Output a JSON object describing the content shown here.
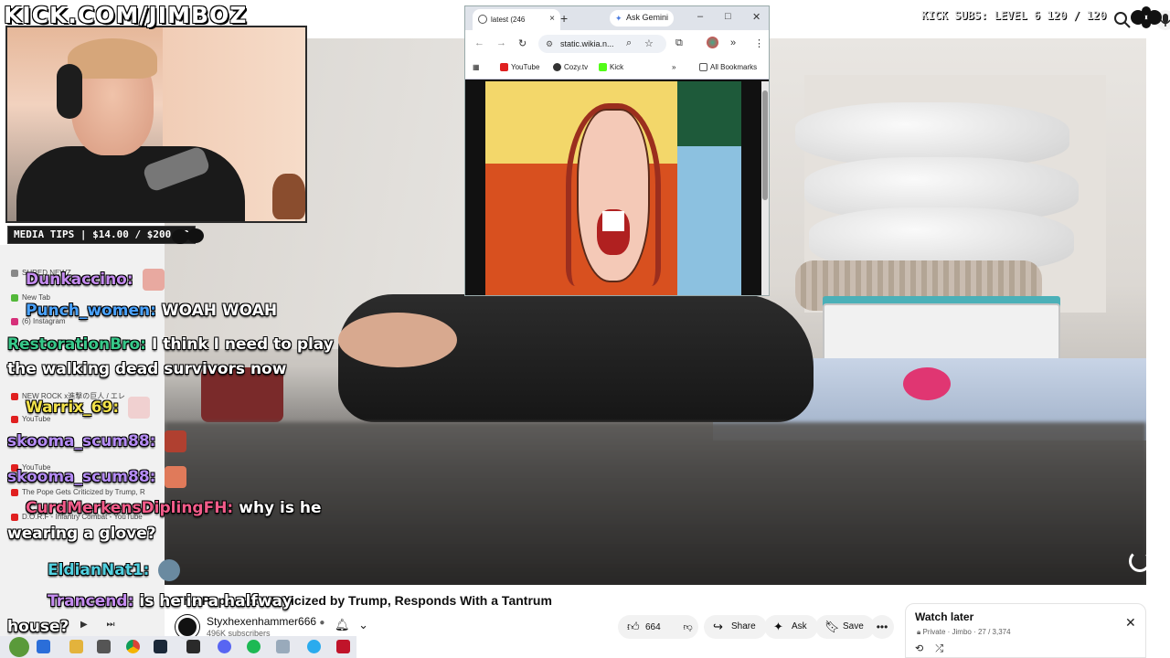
{
  "overlay": {
    "brand": "KICK.COM/JIMBOZ",
    "media_tips": "MEDIA TIPS | $14.00 / $200.00",
    "subs_banner": "KICK SUBS: LEVEL 6 120 / 120"
  },
  "chat": [
    {
      "user": "Dunkaccino:",
      "message": "",
      "color": "#c58cf0"
    },
    {
      "user": "Punch_women:",
      "message": "WOAH WOAH",
      "color": "#4aa3ff"
    },
    {
      "user": "RestorationBro:",
      "message": "I think I need to play",
      "color": "#37c98a"
    },
    {
      "user": "",
      "message": "the walking dead survivors now",
      "color": "#ffffff"
    },
    {
      "user": "Warrix_69:",
      "message": "",
      "color": "#f2e24a"
    },
    {
      "user": "skooma_scum88:",
      "message": "",
      "color": "#b58cf5"
    },
    {
      "user": "skooma_scum88:",
      "message": "",
      "color": "#b58cf5"
    },
    {
      "user": "CurdMerkensDiplingFH:",
      "message": "why is he",
      "color": "#f25c8a"
    },
    {
      "user": "",
      "message": "wearing a glove?",
      "color": "#ffffff"
    },
    {
      "user": "EldianNat1:",
      "message": "",
      "color": "#52d1e0"
    },
    {
      "user": "Trancend:",
      "message": "is he in a halfway",
      "color": "#c58cf0"
    },
    {
      "user": "",
      "message": "house?",
      "color": "#ffffff"
    }
  ],
  "ghost_tabs": [
    "SHRED NEWZ",
    "New Tab",
    "(6) Instagram",
    "NEW ROCK x進撃の巨人 / エレ",
    "YouTube",
    "YouTube",
    "The Pope Gets Criticized by Trump, R",
    "D.O.R.F - Infantry Combat - YouTube"
  ],
  "browser": {
    "tab_title": "latest (246",
    "gemini": "Ask Gemini",
    "url": "static.wikia.n...",
    "bookmarks": [
      "YouTube",
      "Cozy.tv",
      "Kick"
    ],
    "all_bookmarks": "All Bookmarks",
    "new_tab": "+",
    "close": "×",
    "minimize": "–",
    "maximize": "□",
    "window_close": "✕"
  },
  "video": {
    "title": "The Pope Gets Criticized by Trump, Responds With a Tantrum",
    "channel": "Styxhexenhammer666",
    "subscribers": "496K subscribers",
    "likes": "664",
    "share": "Share",
    "ask": "Ask",
    "save": "Save",
    "more": "•••"
  },
  "watch_later": {
    "title": "Watch later",
    "privacy": "Private",
    "meta": "Jimbo · 27 / 3,374",
    "close": "✕"
  },
  "icons": {
    "search": "search-icon",
    "mic": "mic-icon",
    "bell": "bell-icon",
    "like": "thumbs-up-icon",
    "dislike": "thumbs-down-icon",
    "share": "share-icon",
    "ask": "sparkle-icon",
    "save": "bookmark-icon"
  }
}
